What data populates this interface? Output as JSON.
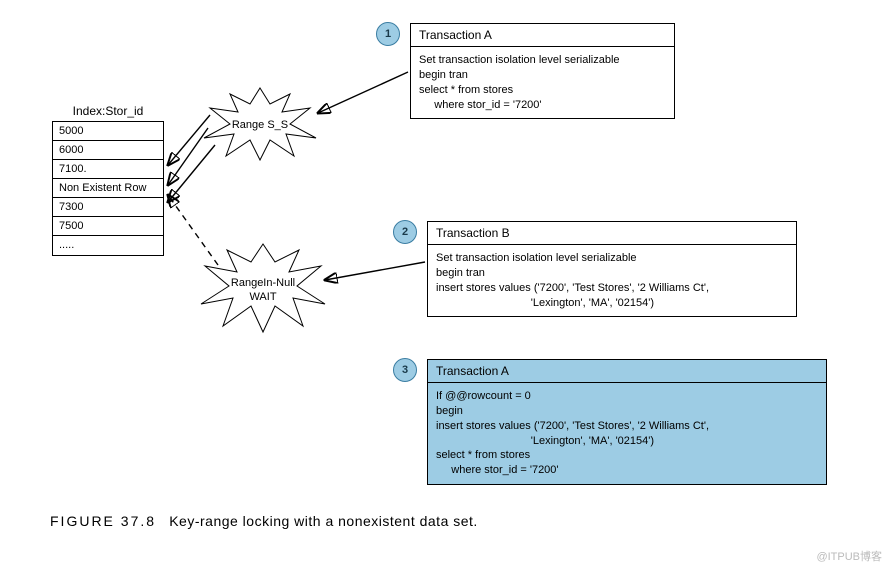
{
  "index": {
    "header": "Index:Stor_id",
    "rows": [
      "5000",
      "6000",
      "7100.",
      "Non Existent Row",
      "7300",
      "7500",
      "....."
    ]
  },
  "bursts": {
    "range_ss": "Range S_S",
    "rangein_null_line1": "RangeIn-Null",
    "rangein_null_line2": "WAIT"
  },
  "steps": {
    "s1": "1",
    "s2": "2",
    "s3": "3"
  },
  "tx": {
    "a": {
      "title": "Transaction A",
      "body": "Set transaction isolation level serializable\nbegin tran\nselect * from stores\n     where stor_id = '7200'"
    },
    "b": {
      "title": "Transaction B",
      "body": "Set transaction isolation level serializable\nbegin tran\ninsert stores values ('7200', 'Test Stores', '2 Williams Ct',\n                               'Lexington', 'MA', '02154')"
    },
    "c": {
      "title": "Transaction A",
      "body": "If @@rowcount = 0\nbegin\ninsert stores values ('7200', 'Test Stores', '2 Williams Ct',\n                               'Lexington', 'MA', '02154')\nselect * from stores\n     where stor_id = '7200'"
    }
  },
  "caption": {
    "fig": "FIGURE 37.8",
    "text": "Key-range locking with a nonexistent data set."
  },
  "watermark": "@ITPUB博客"
}
